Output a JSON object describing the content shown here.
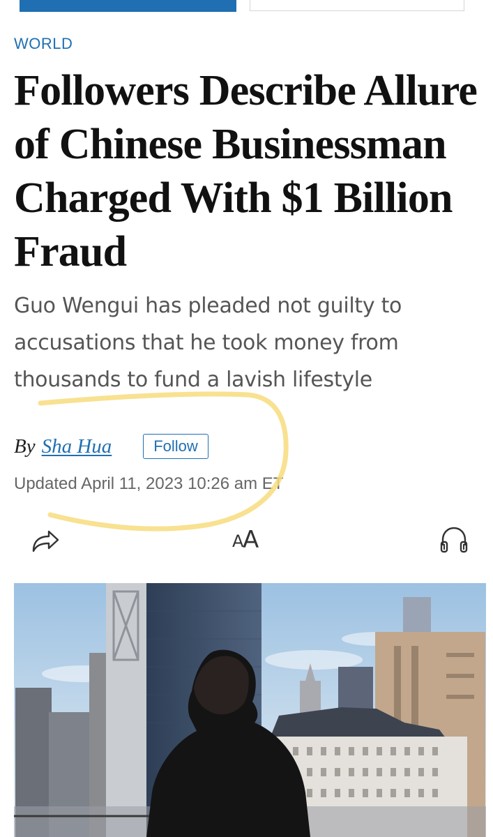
{
  "article": {
    "section": "WORLD",
    "headline": "Followers Describe Allure of Chinese Businessman Charged With $1 Billion Fraud",
    "deck": "Guo Wengui has pleaded not guilty to accusations that he took money from thousands to fund a lavish lifestyle",
    "byline": {
      "prefix": "By",
      "author": "Sha Hua",
      "follow_label": "Follow"
    },
    "updated": "Updated April 11, 2023 10:26 am ET"
  },
  "toolbar": {
    "share_icon": "share-icon",
    "text_size_icon": "text-size-icon",
    "text_size_glyph_small": "A",
    "text_size_glyph_large": "A",
    "listen_icon": "headphones-icon"
  },
  "colors": {
    "accent": "#1f6fb2",
    "highlight": "#f7dc7c",
    "headline": "#111111",
    "deck": "#555555",
    "meta": "#666666"
  }
}
